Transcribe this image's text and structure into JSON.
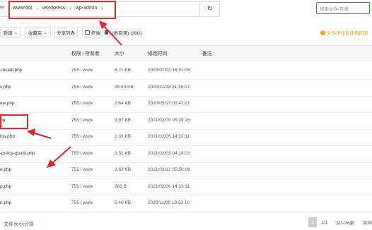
{
  "pathbar": {
    "left_label": "w",
    "crumbs": [
      "wwwroot",
      "wordpress",
      "wp-admin"
    ],
    "refresh_icon": "refresh-icon"
  },
  "search": {
    "placeholder": "搜索文件/目录"
  },
  "toolbar": {
    "new_label": "新建",
    "favorites_label": "收藏夹",
    "share_list_label": "分享列表",
    "terminal_label": "终端",
    "disk_label": "/ (根目录) (38G)",
    "notice": "文件操作可使用回滚"
  },
  "table": {
    "headers": {
      "permission": "权限 / 所有者",
      "size": "大小",
      "mtime": "修改时间",
      "note": "备注"
    },
    "rows": [
      {
        "name": "-install.php",
        "perm": "755 / www",
        "size": "6.21 KB",
        "mtime": "2020/07/03 16:51:05"
      },
      {
        "name": "s.php",
        "perm": "755 / www",
        "size": "28.50 KB",
        "mtime": "2020/11/23 21:36:07"
      },
      {
        "name": "ew.php",
        "perm": "755 / www",
        "size": "2.64 KB",
        "mtime": "2020/05/17 02:42:21"
      },
      {
        "name": "np",
        "perm": "755 / www",
        "size": "9.87 KB",
        "mtime": "2021/02/09 05:39:16"
      },
      {
        "name": "his.php",
        "perm": "755 / www",
        "size": "2.33 KB",
        "mtime": "2021/02/06 14:33:11"
      },
      {
        "name": "-policy-guide.php",
        "perm": "755 / www",
        "size": "3.51 KB",
        "mtime": "2021/02/03 04:14:03"
      },
      {
        "name": "e.php",
        "perm": "755 / www",
        "size": "2.63 KB",
        "mtime": "2021/03/12 05:50:08"
      },
      {
        "name": "p.php",
        "perm": "755 / www",
        "size": "283 B",
        "mtime": "2021/02/06 14:33:11"
      },
      {
        "name": "n.php",
        "perm": "755 / www",
        "size": "5.40 KB",
        "mtime": "2020/11/09 18:53:10"
      }
    ]
  },
  "footer": {
    "size_label": "文件大小:",
    "size_link": "计算",
    "page_current": "1",
    "page_total": "1/1",
    "range": "从1-96条",
    "total": "共96"
  },
  "colors": {
    "accent": "#20a53a",
    "highlight": "#e0262b",
    "notice": "#f0a020"
  }
}
